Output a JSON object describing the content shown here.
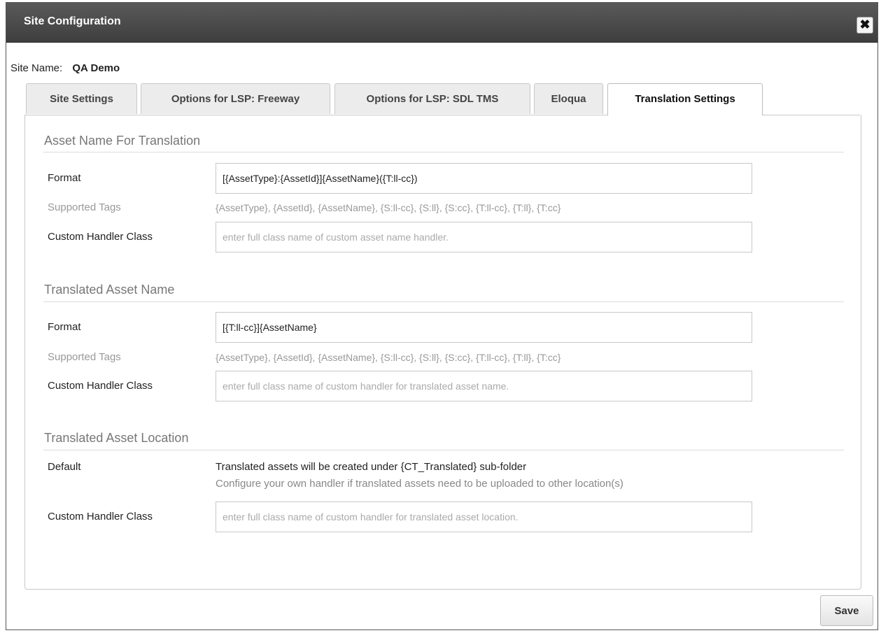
{
  "dialog": {
    "title": "Site Configuration",
    "close_label": "✖",
    "save_label": "Save"
  },
  "site": {
    "name_label": "Site Name:",
    "name_value": "QA Demo"
  },
  "tabs": [
    {
      "label": "Site Settings",
      "active": false
    },
    {
      "label": "Options for LSP: Freeway",
      "active": false
    },
    {
      "label": "Options for LSP: SDL TMS",
      "active": false
    },
    {
      "label": "Eloqua",
      "active": false
    },
    {
      "label": "Translation Settings",
      "active": true
    }
  ],
  "asset_name": {
    "title": "Asset Name For Translation",
    "format_label": "Format",
    "format_value": "[{AssetType}:{AssetId}]{AssetName}({T:ll-cc})",
    "tags_label": "Supported Tags",
    "tags_value": "{AssetType}, {AssetId}, {AssetName}, {S:ll-cc}, {S:ll}, {S:cc}, {T:ll-cc}, {T:ll}, {T:cc}",
    "handler_label": "Custom Handler Class",
    "handler_placeholder": "enter full class name of custom asset name handler."
  },
  "translated_name": {
    "title": "Translated Asset Name",
    "format_label": "Format",
    "format_value": "[{T:ll-cc}]{AssetName}",
    "tags_label": "Supported Tags",
    "tags_value": "{AssetType}, {AssetId}, {AssetName}, {S:ll-cc}, {S:ll}, {S:cc}, {T:ll-cc}, {T:ll}, {T:cc}",
    "handler_label": "Custom Handler Class",
    "handler_placeholder": "enter full class name of custom handler for translated asset name."
  },
  "translated_location": {
    "title": "Translated Asset Location",
    "default_label": "Default",
    "default_text": "Translated assets will be created under {CT_Translated} sub-folder",
    "default_hint": "Configure your own handler if translated assets need to be uploaded to other location(s)",
    "handler_label": "Custom Handler Class",
    "handler_placeholder": "enter full class name of custom handler for translated asset location."
  }
}
